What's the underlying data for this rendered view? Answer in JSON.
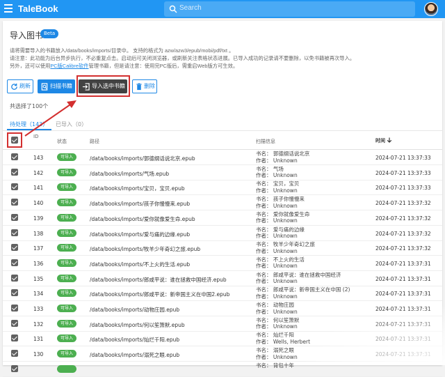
{
  "app": {
    "title": "TaleBook",
    "search_placeholder": "Search"
  },
  "page": {
    "title": "导入图书",
    "beta": "Beta",
    "desc1": "请将需要导入的书籍放入/data/books/imports/目录中。 支持的格式为 azw/azw3/epub/mobi/pdf/txt 。",
    "desc2": "请注意：此功能为后台异步执行，不必重复点击。启动后可关闭浏览器，或刷新关注表格状态进展。已导入成功的记录请不要删除，以免书籍被再次导入。",
    "desc3_pre": "另外，还可以使用",
    "desc3_link": "PC版Calibre软件",
    "desc3_post": "管理书籍，但是请注意：使用完PC版后，需重启Web版方可生效。"
  },
  "toolbar": {
    "refresh": "刷新",
    "scan": "扫描书籍",
    "import_selected": "导入选中书籍",
    "delete": "删除"
  },
  "selected_count": "共选择了100个",
  "tabs": {
    "pending": "待处理（143）",
    "done": "已导入（0）"
  },
  "table": {
    "headers": {
      "id": "ID",
      "status": "状态",
      "path": "路径",
      "scan": "扫描信息",
      "time": "时间"
    },
    "rows": [
      {
        "id": "143",
        "status": "可导入",
        "path": "/data/books/imports/郭德纲话说北京.epub",
        "title": "书名： 郭德纲话说北京",
        "author": "作者： Unknown",
        "time": "2024-07-21 13:37:33"
      },
      {
        "id": "142",
        "status": "可导入",
        "path": "/data/books/imports/气场.epub",
        "title": "书名： 气场",
        "author": "作者： Unknown",
        "time": "2024-07-21 13:37:33"
      },
      {
        "id": "141",
        "status": "可导入",
        "path": "/data/books/imports/宝贝，宝贝.epub",
        "title": "书名： 宝贝，宝贝",
        "author": "作者： Unknown",
        "time": "2024-07-21 13:37:33"
      },
      {
        "id": "140",
        "status": "可导入",
        "path": "/data/books/imports/孩子你慢慢来.epub",
        "title": "书名： 孩子你慢慢来",
        "author": "作者： Unknown",
        "time": "2024-07-21 13:37:32"
      },
      {
        "id": "139",
        "status": "可导入",
        "path": "/data/books/imports/爱你就像爱生命.epub",
        "title": "书名： 爱你就像爱生命",
        "author": "作者： Unknown",
        "time": "2024-07-21 13:37:32"
      },
      {
        "id": "138",
        "status": "可导入",
        "path": "/data/books/imports/爱与痛的边缘.epub",
        "title": "书名： 爱与痛的边缘",
        "author": "作者： Unknown",
        "time": "2024-07-21 13:37:32"
      },
      {
        "id": "137",
        "status": "可导入",
        "path": "/data/books/imports/牧羊少年奇幻之旅.epub",
        "title": "书名： 牧羊少年奇幻之旅",
        "author": "作者： Unknown",
        "time": "2024-07-21 13:37:32"
      },
      {
        "id": "136",
        "status": "可导入",
        "path": "/data/books/imports/不上火的生活.epub",
        "title": "书名： 不上火的生活",
        "author": "作者： Unknown",
        "time": "2024-07-21 13:37:31"
      },
      {
        "id": "135",
        "status": "可导入",
        "path": "/data/books/imports/郎咸平说：谁在拯救中国经济.epub",
        "title": "书名： 郎咸平说：谁在拯救中国经济",
        "author": "作者： Unknown",
        "time": "2024-07-21 13:37:31"
      },
      {
        "id": "134",
        "status": "可导入",
        "path": "/data/books/imports/郎咸平说：新帝国主义在中国2.epub",
        "title": "书名： 郎咸平说：新帝国主义在中国 (2)",
        "author": "作者： Unknown",
        "time": "2024-07-21 13:37:31"
      },
      {
        "id": "133",
        "status": "可导入",
        "path": "/data/books/imports/动物庄园.epub",
        "title": "书名： 动物庄园",
        "author": "作者： Unknown",
        "time": "2024-07-21 13:37:31"
      },
      {
        "id": "132",
        "status": "可导入",
        "path": "/data/books/imports/何以笙箫默.epub",
        "title": "书名： 何以笙箫默",
        "author": "作者： Unknown",
        "time": "2024-07-21 13:37:31"
      },
      {
        "id": "131",
        "status": "可导入",
        "path": "/data/books/imports/灿烂千阳.epub",
        "title": "书名： 灿烂千阳",
        "author": "作者： Wells, Herbert",
        "time": "2024-07-21 13:37:31"
      },
      {
        "id": "130",
        "status": "可导入",
        "path": "/data/books/imports/溺死之眼.epub",
        "title": "书名： 溺死之眼",
        "author": "作者： Unknown",
        "time": "2024-07-21 13:37:31"
      },
      {
        "id": "",
        "status": "",
        "path": "",
        "title": "书名： 背包十年",
        "author": "",
        "time": ""
      }
    ]
  },
  "colors": {
    "primary": "#2196f3",
    "accent": "#1e88e5",
    "badge": "#4caf50",
    "highlight": "#d32f2f"
  }
}
